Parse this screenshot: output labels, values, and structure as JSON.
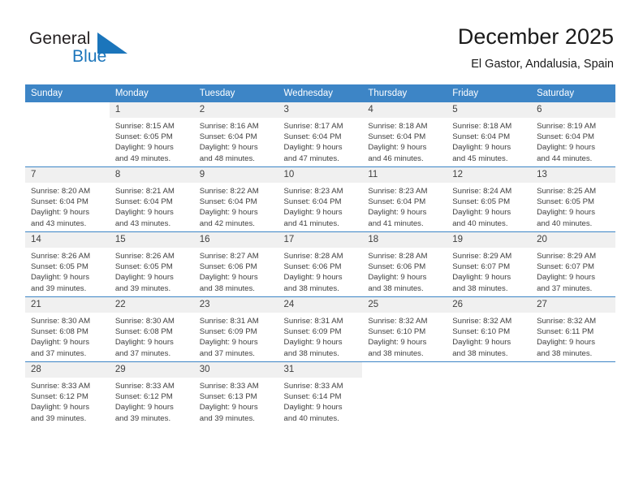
{
  "brand": {
    "name_part1": "General",
    "name_part2": "Blue",
    "accent_color": "#1b75bb",
    "logo_icon": "triangle-flag-icon"
  },
  "header": {
    "title": "December 2025",
    "location": "El Gastor, Andalusia, Spain",
    "header_bg_color": "#3d85c6",
    "cell_band_color": "#f0f0f0"
  },
  "weekdays": [
    "Sunday",
    "Monday",
    "Tuesday",
    "Wednesday",
    "Thursday",
    "Friday",
    "Saturday"
  ],
  "weeks": [
    [
      {
        "day": "",
        "sunrise": "",
        "sunset": "",
        "daylight_1": "",
        "daylight_2": ""
      },
      {
        "day": "1",
        "sunrise": "Sunrise: 8:15 AM",
        "sunset": "Sunset: 6:05 PM",
        "daylight_1": "Daylight: 9 hours",
        "daylight_2": "and 49 minutes."
      },
      {
        "day": "2",
        "sunrise": "Sunrise: 8:16 AM",
        "sunset": "Sunset: 6:04 PM",
        "daylight_1": "Daylight: 9 hours",
        "daylight_2": "and 48 minutes."
      },
      {
        "day": "3",
        "sunrise": "Sunrise: 8:17 AM",
        "sunset": "Sunset: 6:04 PM",
        "daylight_1": "Daylight: 9 hours",
        "daylight_2": "and 47 minutes."
      },
      {
        "day": "4",
        "sunrise": "Sunrise: 8:18 AM",
        "sunset": "Sunset: 6:04 PM",
        "daylight_1": "Daylight: 9 hours",
        "daylight_2": "and 46 minutes."
      },
      {
        "day": "5",
        "sunrise": "Sunrise: 8:18 AM",
        "sunset": "Sunset: 6:04 PM",
        "daylight_1": "Daylight: 9 hours",
        "daylight_2": "and 45 minutes."
      },
      {
        "day": "6",
        "sunrise": "Sunrise: 8:19 AM",
        "sunset": "Sunset: 6:04 PM",
        "daylight_1": "Daylight: 9 hours",
        "daylight_2": "and 44 minutes."
      }
    ],
    [
      {
        "day": "7",
        "sunrise": "Sunrise: 8:20 AM",
        "sunset": "Sunset: 6:04 PM",
        "daylight_1": "Daylight: 9 hours",
        "daylight_2": "and 43 minutes."
      },
      {
        "day": "8",
        "sunrise": "Sunrise: 8:21 AM",
        "sunset": "Sunset: 6:04 PM",
        "daylight_1": "Daylight: 9 hours",
        "daylight_2": "and 43 minutes."
      },
      {
        "day": "9",
        "sunrise": "Sunrise: 8:22 AM",
        "sunset": "Sunset: 6:04 PM",
        "daylight_1": "Daylight: 9 hours",
        "daylight_2": "and 42 minutes."
      },
      {
        "day": "10",
        "sunrise": "Sunrise: 8:23 AM",
        "sunset": "Sunset: 6:04 PM",
        "daylight_1": "Daylight: 9 hours",
        "daylight_2": "and 41 minutes."
      },
      {
        "day": "11",
        "sunrise": "Sunrise: 8:23 AM",
        "sunset": "Sunset: 6:04 PM",
        "daylight_1": "Daylight: 9 hours",
        "daylight_2": "and 41 minutes."
      },
      {
        "day": "12",
        "sunrise": "Sunrise: 8:24 AM",
        "sunset": "Sunset: 6:05 PM",
        "daylight_1": "Daylight: 9 hours",
        "daylight_2": "and 40 minutes."
      },
      {
        "day": "13",
        "sunrise": "Sunrise: 8:25 AM",
        "sunset": "Sunset: 6:05 PM",
        "daylight_1": "Daylight: 9 hours",
        "daylight_2": "and 40 minutes."
      }
    ],
    [
      {
        "day": "14",
        "sunrise": "Sunrise: 8:26 AM",
        "sunset": "Sunset: 6:05 PM",
        "daylight_1": "Daylight: 9 hours",
        "daylight_2": "and 39 minutes."
      },
      {
        "day": "15",
        "sunrise": "Sunrise: 8:26 AM",
        "sunset": "Sunset: 6:05 PM",
        "daylight_1": "Daylight: 9 hours",
        "daylight_2": "and 39 minutes."
      },
      {
        "day": "16",
        "sunrise": "Sunrise: 8:27 AM",
        "sunset": "Sunset: 6:06 PM",
        "daylight_1": "Daylight: 9 hours",
        "daylight_2": "and 38 minutes."
      },
      {
        "day": "17",
        "sunrise": "Sunrise: 8:28 AM",
        "sunset": "Sunset: 6:06 PM",
        "daylight_1": "Daylight: 9 hours",
        "daylight_2": "and 38 minutes."
      },
      {
        "day": "18",
        "sunrise": "Sunrise: 8:28 AM",
        "sunset": "Sunset: 6:06 PM",
        "daylight_1": "Daylight: 9 hours",
        "daylight_2": "and 38 minutes."
      },
      {
        "day": "19",
        "sunrise": "Sunrise: 8:29 AM",
        "sunset": "Sunset: 6:07 PM",
        "daylight_1": "Daylight: 9 hours",
        "daylight_2": "and 38 minutes."
      },
      {
        "day": "20",
        "sunrise": "Sunrise: 8:29 AM",
        "sunset": "Sunset: 6:07 PM",
        "daylight_1": "Daylight: 9 hours",
        "daylight_2": "and 37 minutes."
      }
    ],
    [
      {
        "day": "21",
        "sunrise": "Sunrise: 8:30 AM",
        "sunset": "Sunset: 6:08 PM",
        "daylight_1": "Daylight: 9 hours",
        "daylight_2": "and 37 minutes."
      },
      {
        "day": "22",
        "sunrise": "Sunrise: 8:30 AM",
        "sunset": "Sunset: 6:08 PM",
        "daylight_1": "Daylight: 9 hours",
        "daylight_2": "and 37 minutes."
      },
      {
        "day": "23",
        "sunrise": "Sunrise: 8:31 AM",
        "sunset": "Sunset: 6:09 PM",
        "daylight_1": "Daylight: 9 hours",
        "daylight_2": "and 37 minutes."
      },
      {
        "day": "24",
        "sunrise": "Sunrise: 8:31 AM",
        "sunset": "Sunset: 6:09 PM",
        "daylight_1": "Daylight: 9 hours",
        "daylight_2": "and 38 minutes."
      },
      {
        "day": "25",
        "sunrise": "Sunrise: 8:32 AM",
        "sunset": "Sunset: 6:10 PM",
        "daylight_1": "Daylight: 9 hours",
        "daylight_2": "and 38 minutes."
      },
      {
        "day": "26",
        "sunrise": "Sunrise: 8:32 AM",
        "sunset": "Sunset: 6:10 PM",
        "daylight_1": "Daylight: 9 hours",
        "daylight_2": "and 38 minutes."
      },
      {
        "day": "27",
        "sunrise": "Sunrise: 8:32 AM",
        "sunset": "Sunset: 6:11 PM",
        "daylight_1": "Daylight: 9 hours",
        "daylight_2": "and 38 minutes."
      }
    ],
    [
      {
        "day": "28",
        "sunrise": "Sunrise: 8:33 AM",
        "sunset": "Sunset: 6:12 PM",
        "daylight_1": "Daylight: 9 hours",
        "daylight_2": "and 39 minutes."
      },
      {
        "day": "29",
        "sunrise": "Sunrise: 8:33 AM",
        "sunset": "Sunset: 6:12 PM",
        "daylight_1": "Daylight: 9 hours",
        "daylight_2": "and 39 minutes."
      },
      {
        "day": "30",
        "sunrise": "Sunrise: 8:33 AM",
        "sunset": "Sunset: 6:13 PM",
        "daylight_1": "Daylight: 9 hours",
        "daylight_2": "and 39 minutes."
      },
      {
        "day": "31",
        "sunrise": "Sunrise: 8:33 AM",
        "sunset": "Sunset: 6:14 PM",
        "daylight_1": "Daylight: 9 hours",
        "daylight_2": "and 40 minutes."
      },
      {
        "day": "",
        "sunrise": "",
        "sunset": "",
        "daylight_1": "",
        "daylight_2": ""
      },
      {
        "day": "",
        "sunrise": "",
        "sunset": "",
        "daylight_1": "",
        "daylight_2": ""
      },
      {
        "day": "",
        "sunrise": "",
        "sunset": "",
        "daylight_1": "",
        "daylight_2": ""
      }
    ]
  ]
}
